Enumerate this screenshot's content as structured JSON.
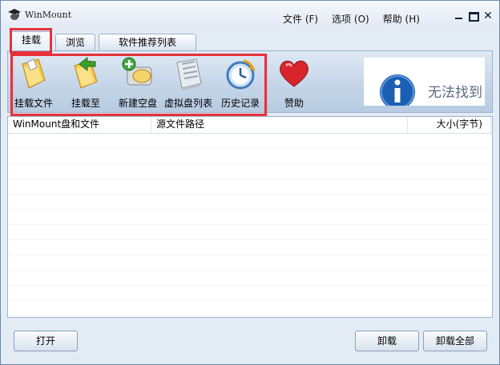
{
  "app": {
    "title": "WinMount"
  },
  "menu": [
    {
      "label": "文件 (F)"
    },
    {
      "label": "选项 (O)"
    },
    {
      "label": "帮助 (H)"
    }
  ],
  "window_controls": {
    "close": "✕"
  },
  "tabs": [
    {
      "label": "挂载"
    },
    {
      "label": "浏览"
    },
    {
      "label": "软件推荐列表"
    }
  ],
  "toolbar": {
    "buttons": [
      {
        "label": "挂载文件",
        "icon": "mount-file-icon"
      },
      {
        "label": "挂载至",
        "icon": "mount-to-icon"
      },
      {
        "label": "新建空盘",
        "icon": "new-disk-icon"
      },
      {
        "label": "虚拟盘列表",
        "icon": "virtual-disk-list-icon"
      },
      {
        "label": "历史记录",
        "icon": "history-icon"
      },
      {
        "label": "赞助",
        "icon": "heart-icon"
      }
    ]
  },
  "banner": {
    "text": "无法找到",
    "icon": "info-icon"
  },
  "list": {
    "columns": [
      {
        "label": "WinMount盘和文件"
      },
      {
        "label": "源文件路径"
      },
      {
        "label": "大小(字节)"
      }
    ]
  },
  "buttons": {
    "open": "打开",
    "unmount": "卸载",
    "unmount_all": "卸载全部"
  },
  "colors": {
    "highlight": "#e8303a",
    "toolbar": "#c7d7e9",
    "accent": "#1a5fb4"
  }
}
